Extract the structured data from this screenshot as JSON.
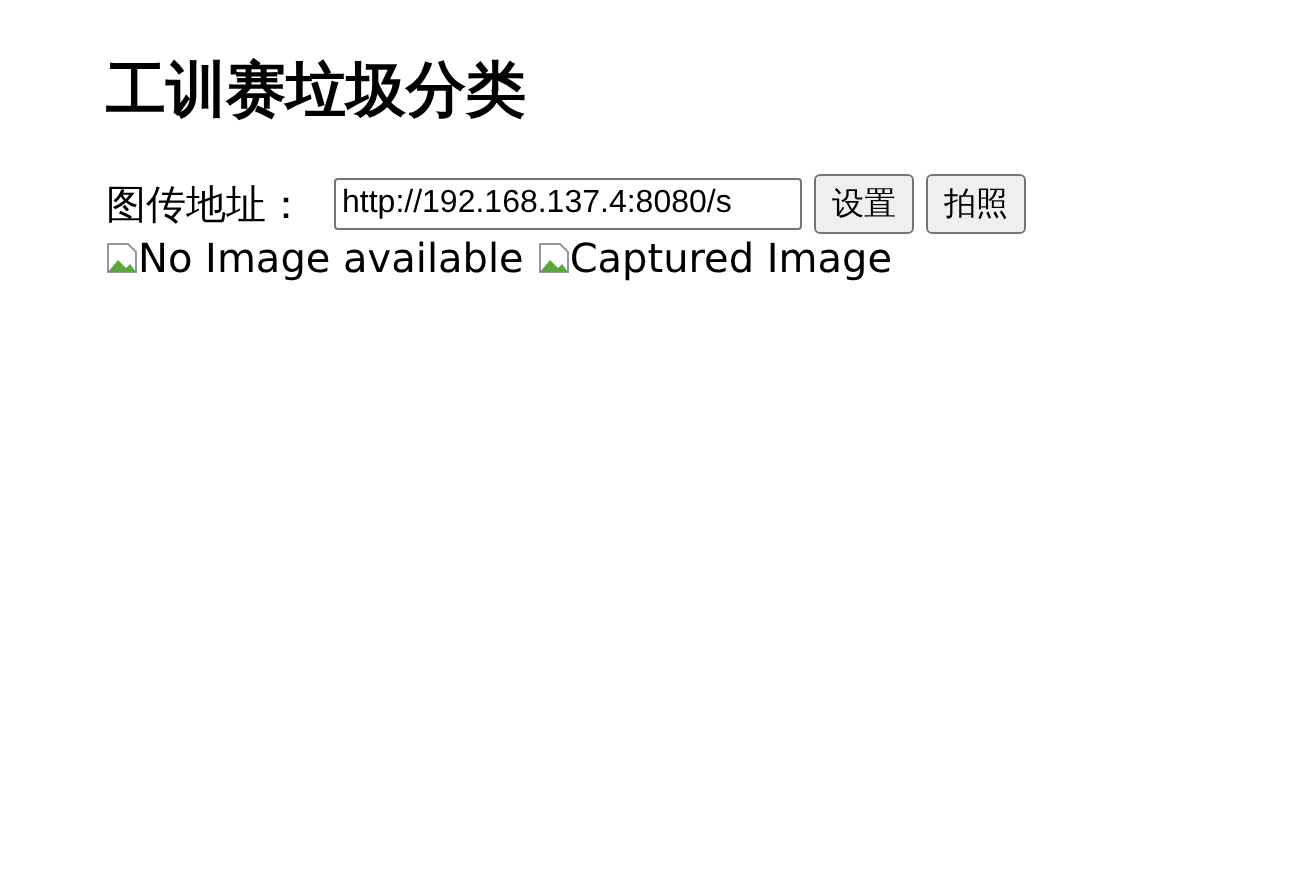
{
  "title": "工训赛垃圾分类",
  "address": {
    "label": "图传地址：",
    "value": "http://192.168.137.4:8080/s"
  },
  "buttons": [
    "设置",
    "拍照"
  ],
  "images": [
    {
      "alt": "No Image available"
    },
    {
      "alt": "Captured Image"
    }
  ]
}
